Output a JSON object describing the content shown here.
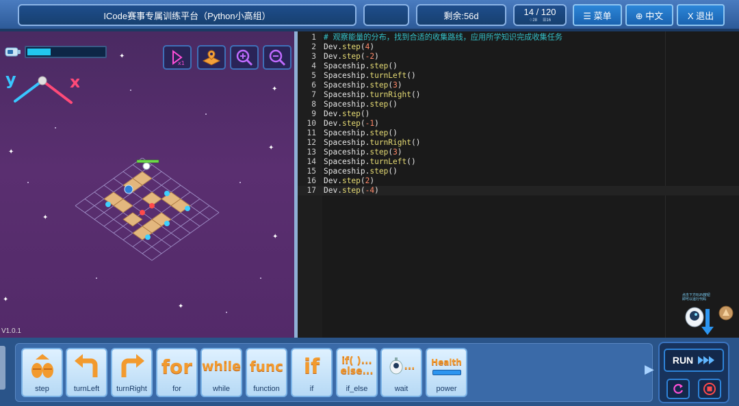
{
  "header": {
    "title": "ICode赛事专属训练平台（Python小高组）",
    "remaining": "剩余:56d",
    "progress": "14 / 120",
    "progress_sub_a": "♢28",
    "progress_sub_b": "☰16",
    "menu_label": "☰ 菜单",
    "lang_label": "⊕ 中文",
    "exit_label": "X 退出"
  },
  "game": {
    "energy_level": 0.3,
    "axis_y": "y",
    "axis_x": "x",
    "version": "V1.0.1",
    "toolbar": [
      "speed-icon",
      "map-icon",
      "zoom-in-icon",
      "zoom-out-icon"
    ],
    "accent_color": "#22c7f0"
  },
  "editor": {
    "lines": [
      {
        "n": "1",
        "t": "# 观察能量的分布，找到合适的收集路线，应用所学知识完成收集任务"
      },
      {
        "n": "2",
        "t": "Dev.step(4)"
      },
      {
        "n": "3",
        "t": "Dev.step(-2)"
      },
      {
        "n": "4",
        "t": "Spaceship.step()"
      },
      {
        "n": "5",
        "t": "Spaceship.turnLeft()"
      },
      {
        "n": "6",
        "t": "Spaceship.step(3)"
      },
      {
        "n": "7",
        "t": "Spaceship.turnRight()"
      },
      {
        "n": "8",
        "t": "Spaceship.step()"
      },
      {
        "n": "9",
        "t": "Dev.step()"
      },
      {
        "n": "10",
        "t": "Dev.step(-1)"
      },
      {
        "n": "11",
        "t": "Spaceship.step()"
      },
      {
        "n": "12",
        "t": "Spaceship.turnRight()"
      },
      {
        "n": "13",
        "t": "Spaceship.step(3)"
      },
      {
        "n": "14",
        "t": "Spaceship.turnLeft()"
      },
      {
        "n": "15",
        "t": "Spaceship.step()"
      },
      {
        "n": "16",
        "t": "Dev.step(2)"
      },
      {
        "n": "17",
        "t": "Dev.step(-4)"
      }
    ],
    "active_line": "17",
    "robot_tip_1": "点击下方RUN按钮",
    "robot_tip_2": "即可以运行代码"
  },
  "blocks": [
    {
      "icon": "step-icon",
      "label": "step"
    },
    {
      "icon": "turn-left-icon",
      "label": "turnLeft"
    },
    {
      "icon": "turn-right-icon",
      "label": "turnRight"
    },
    {
      "icon": "for-icon",
      "label": "for",
      "glyph": "for"
    },
    {
      "icon": "while-icon",
      "label": "while",
      "glyph": "while"
    },
    {
      "icon": "function-icon",
      "label": "function",
      "glyph": "func"
    },
    {
      "icon": "if-icon",
      "label": "if",
      "glyph": "if"
    },
    {
      "icon": "if-else-icon",
      "label": "if_else",
      "glyph": "if( )...",
      "glyph2": "else..."
    },
    {
      "icon": "wait-icon",
      "label": "wait",
      "glyph": "..."
    },
    {
      "icon": "power-icon",
      "label": "power",
      "glyph": "Health"
    }
  ],
  "controls": {
    "run_label": "RUN"
  }
}
